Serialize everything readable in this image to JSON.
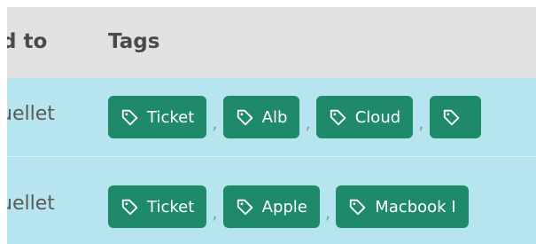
{
  "header": {
    "assigned_label": "d to",
    "tags_label": "Tags"
  },
  "rows": [
    {
      "assigned": "uellet",
      "tags": [
        "Ticket",
        "Alb",
        "Cloud",
        ""
      ]
    },
    {
      "assigned": "uellet",
      "tags": [
        "Ticket",
        "Apple",
        "Macbook I"
      ]
    }
  ],
  "separator": ",",
  "colors": {
    "header_bg": "#e2e2e2",
    "row_bg": "#b7e5ef",
    "tag_bg": "#1f8a6a",
    "tag_text": "#ffffff"
  },
  "icons": {
    "tag": "tag-icon"
  }
}
